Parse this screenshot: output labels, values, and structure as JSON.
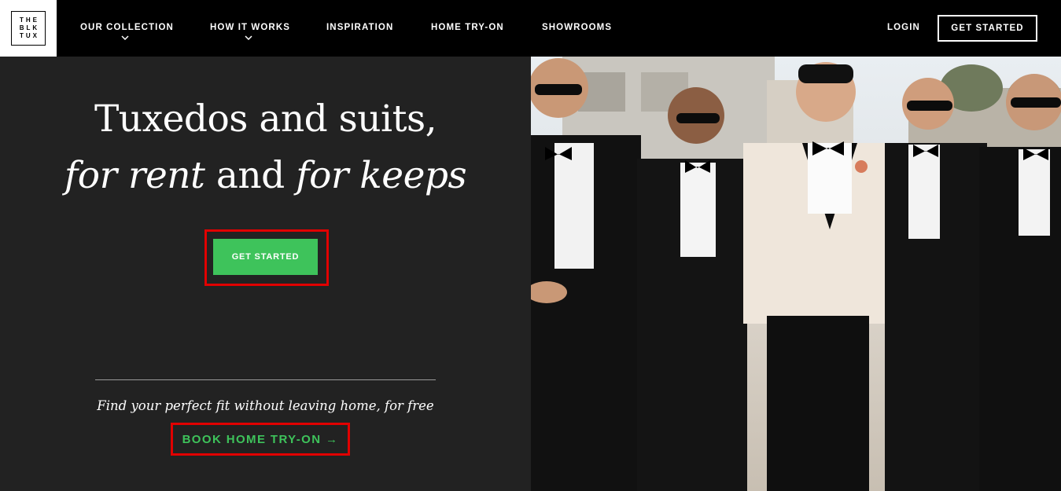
{
  "brand": {
    "logo_lines": [
      "THE",
      "BLK",
      "TUX"
    ]
  },
  "nav": {
    "items": [
      {
        "label": "OUR COLLECTION",
        "has_dropdown": true
      },
      {
        "label": "HOW IT WORKS",
        "has_dropdown": true
      },
      {
        "label": "INSPIRATION",
        "has_dropdown": false
      },
      {
        "label": "HOME TRY-ON",
        "has_dropdown": false
      },
      {
        "label": "SHOWROOMS",
        "has_dropdown": false
      }
    ],
    "login_label": "LOGIN",
    "get_started_label": "GET STARTED"
  },
  "hero": {
    "headline_line1": "Tuxedos and suits,",
    "headline_line2_part1": "for rent",
    "headline_line2_part2": " and ",
    "headline_line2_part3": "for keeps",
    "cta_label": "GET STARTED",
    "tagline": "Find your perfect fit without leaving home, for free",
    "book_label": "BOOK HOME TRY-ON →"
  },
  "colors": {
    "accent_green": "#3ec35b",
    "highlight_red": "#e10000",
    "nav_bg": "#000000",
    "hero_bg": "#222222"
  },
  "photo": {
    "subject": "five men in tuxedos walking outdoors, center man in white dinner jacket"
  }
}
